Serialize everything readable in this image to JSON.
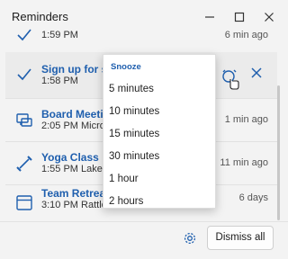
{
  "window": {
    "title": "Reminders"
  },
  "reminders": [
    {
      "title": "",
      "subtitle": "1:59 PM",
      "time": "6 min ago",
      "icon": "check-icon"
    },
    {
      "title": "Sign up for swir",
      "subtitle": "1:58 PM",
      "time": "",
      "icon": "check-icon"
    },
    {
      "title": "Board Meeting",
      "subtitle": "2:05 PM Micros",
      "time": "1 min ago",
      "icon": "chat-icon"
    },
    {
      "title": "Yoga Class",
      "subtitle": "1:55 PM Lake Ur",
      "time": "11 min ago",
      "icon": "dumbbell-icon"
    },
    {
      "title": "Team Retreat",
      "subtitle": "3:10 PM Rattles",
      "time": "6 days",
      "icon": "calendar-icon"
    }
  ],
  "snooze_menu": {
    "header": "Snooze",
    "options": [
      "5 minutes",
      "10 minutes",
      "15 minutes",
      "30 minutes",
      "1 hour",
      "2 hours"
    ]
  },
  "footer": {
    "dismiss_all_label": "Dismiss all"
  },
  "colors": {
    "accent": "#1f5fae",
    "background": "#f3f3f3",
    "highlight": "#ebebeb"
  }
}
